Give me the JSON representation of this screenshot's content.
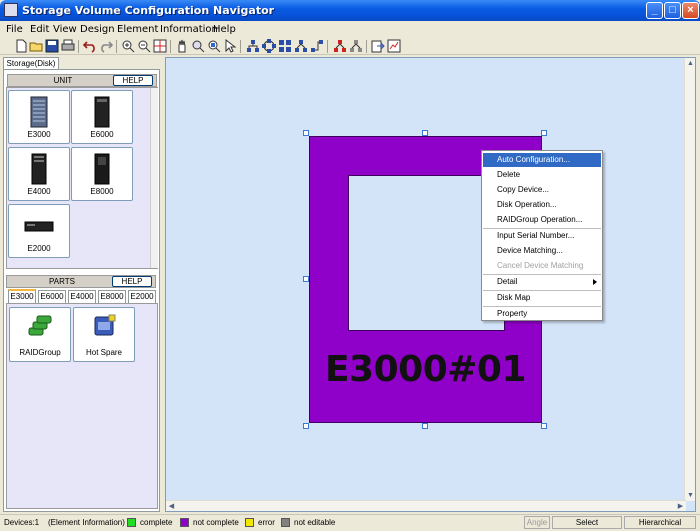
{
  "window": {
    "title": "Storage Volume Configuration Navigator"
  },
  "menu": [
    "File",
    "Edit",
    "View",
    "Design",
    "Element",
    "Information",
    "Help"
  ],
  "left_panel": {
    "tab": "Storage(Disk)",
    "unit_section": {
      "title": "UNIT",
      "help": "HELP",
      "items": [
        "E3000",
        "E6000",
        "E4000",
        "E8000",
        "E2000"
      ]
    },
    "parts_section": {
      "title": "PARTS",
      "help": "HELP",
      "tabs": [
        "E3000",
        "E6000",
        "E4000",
        "E8000",
        "E2000"
      ],
      "active_tab": "E3000",
      "items": [
        "RAIDGroup",
        "Hot Spare"
      ]
    }
  },
  "canvas": {
    "unit_label": "E3000#01",
    "unit_color": "#8f00c8"
  },
  "context_menu": {
    "items": [
      {
        "label": "Auto Configuration...",
        "selected": true
      },
      {
        "label": "Delete"
      },
      {
        "label": "Copy Device..."
      },
      {
        "label": "Disk Operation..."
      },
      {
        "label": "RAIDGroup Operation..."
      },
      {
        "label": "Input Serial Number..."
      },
      {
        "label": "Device Matching..."
      },
      {
        "label": "Cancel Device Matching",
        "disabled": true
      },
      {
        "label": "Detail",
        "submenu": true
      },
      {
        "label": "Disk Map"
      },
      {
        "label": "Property"
      }
    ]
  },
  "status": {
    "devices": "Devices:1",
    "element_info": "(Element Information)",
    "legend": [
      {
        "label": "complete",
        "color": "#22dd22"
      },
      {
        "label": "not complete",
        "color": "#8f00c8"
      },
      {
        "label": "error",
        "color": "#f0e800"
      },
      {
        "label": "not editable",
        "color": "#808080"
      }
    ],
    "angle": "Angle",
    "mode": "Select",
    "layout": "Hierarchical"
  }
}
